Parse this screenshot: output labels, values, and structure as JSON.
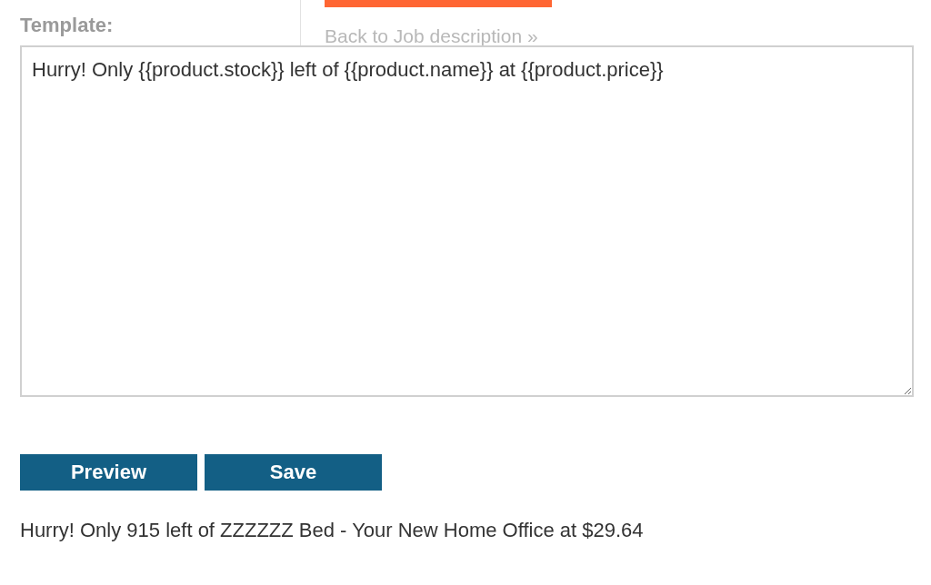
{
  "form": {
    "label": "Template:",
    "template_text": "Hurry! Only {{product.stock}} left of {{product.name}} at {{product.price}}"
  },
  "side_panel": {
    "link": "Back to Job description »"
  },
  "buttons": [
    {
      "label": "Preview"
    },
    {
      "label": "Save"
    }
  ],
  "preview_output": "Hurry! Only 915 left of ZZZZZZ Bed - Your New Home Office at $29.64"
}
